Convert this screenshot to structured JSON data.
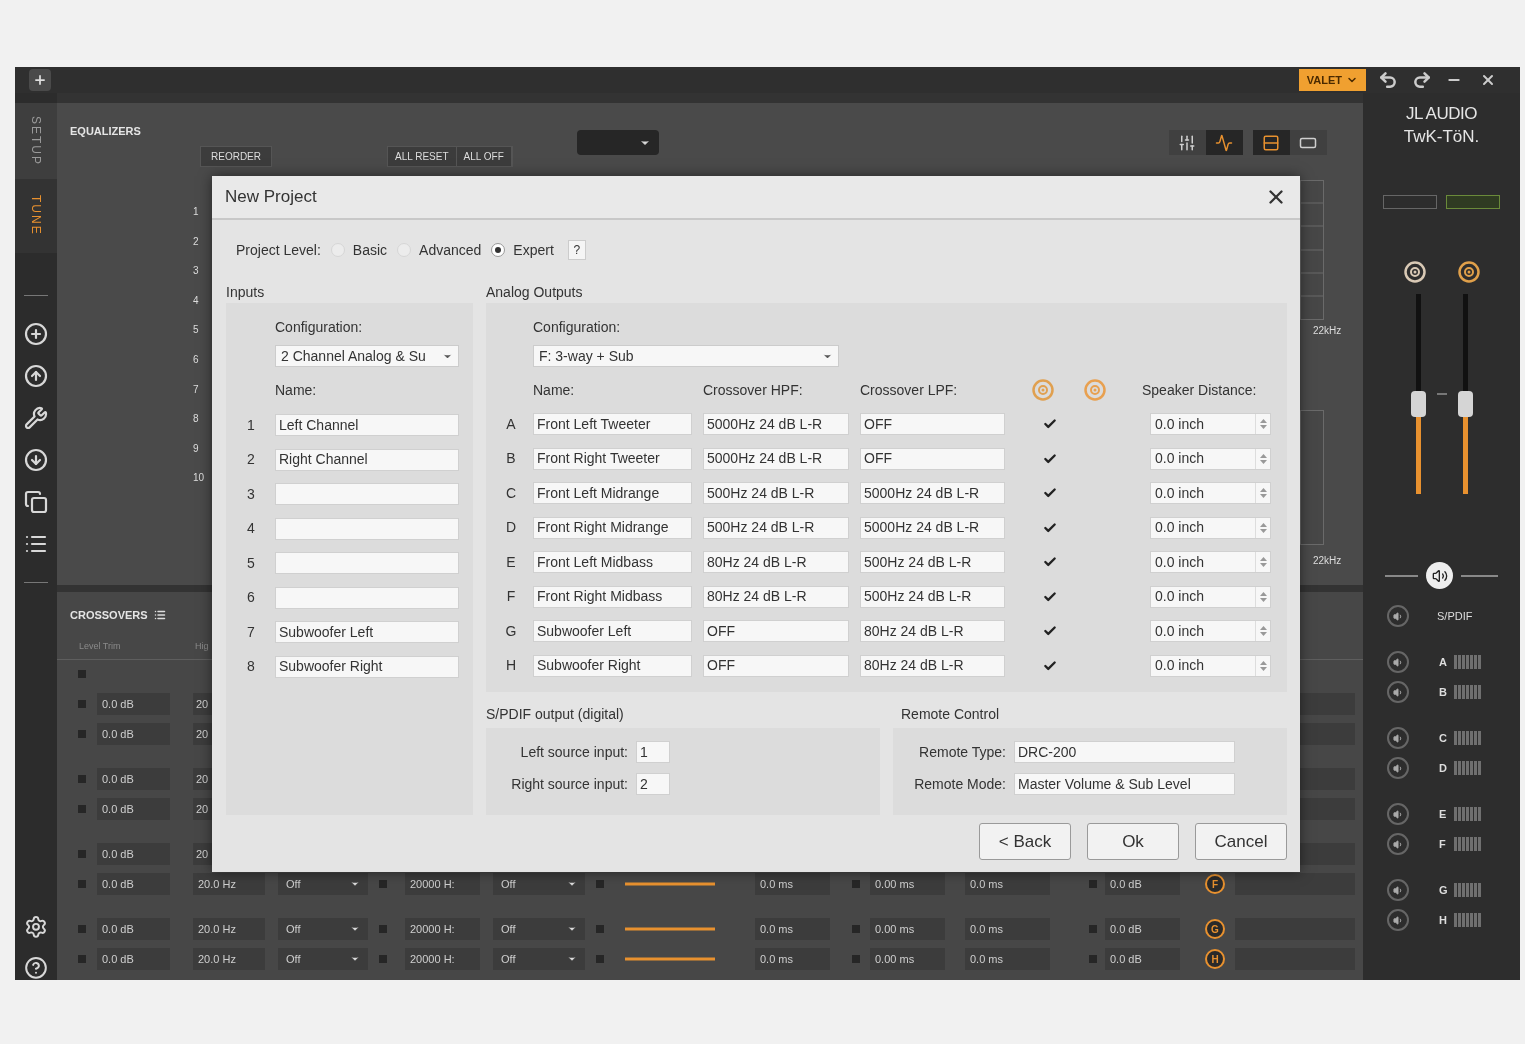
{
  "top_bar": {
    "valet": "VALET"
  },
  "side_tabs": [
    {
      "label": "SETUP",
      "selected": false
    },
    {
      "label": "TUNE",
      "selected": true
    }
  ],
  "equalizers": {
    "title": "EQUALIZERS",
    "reorder": "REORDER",
    "buttons": [
      "ALL RESET",
      "ALL OFF"
    ],
    "view_buttons": [
      {
        "selected": false
      },
      {
        "selected": true
      },
      {
        "selected": true
      },
      {
        "selected": false
      }
    ],
    "band_numbers": [
      "1",
      "2",
      "3",
      "4",
      "5",
      "6",
      "7",
      "8",
      "9",
      "10"
    ],
    "freq_labels": [
      "22kHz",
      "22kHz"
    ]
  },
  "crossovers": {
    "title": "CROSSOVERS",
    "columns": [
      "Level Trim",
      "Hig"
    ],
    "groups": [
      [
        {
          "kind": "blank"
        },
        {
          "kind": "partial",
          "level": "0.0 dB",
          "hz": "20"
        },
        {
          "kind": "partial",
          "level": "0.0 dB",
          "hz": "20"
        }
      ],
      [
        {
          "kind": "partial",
          "level": "0.0 dB",
          "hz": "20"
        },
        {
          "kind": "partial",
          "level": "0.0 dB",
          "hz": "20"
        }
      ],
      [
        {
          "kind": "partial",
          "level": "0.0 dB",
          "hz": "20"
        },
        {
          "kind": "full",
          "level": "0.0 dB",
          "hpf_freq": "20.0 Hz",
          "hpf_slope": "Off",
          "lpf_freq": "20000 H:",
          "lpf_slope": "Off",
          "delay": "0.0 ms",
          "delay_fine": "0.00 ms",
          "delay_total": "0.0 ms",
          "gain": "0.0 dB",
          "letter": "F"
        }
      ],
      [
        {
          "kind": "full",
          "level": "0.0 dB",
          "hpf_freq": "20.0 Hz",
          "hpf_slope": "Off",
          "lpf_freq": "20000 H:",
          "lpf_slope": "Off",
          "delay": "0.0 ms",
          "delay_fine": "0.00 ms",
          "delay_total": "0.0 ms",
          "gain": "0.0 dB",
          "letter": "G"
        },
        {
          "kind": "full",
          "level": "0.0 dB",
          "hpf_freq": "20.0 Hz",
          "hpf_slope": "Off",
          "lpf_freq": "20000 H:",
          "lpf_slope": "Off",
          "delay": "0.0 ms",
          "delay_fine": "0.00 ms",
          "delay_total": "0.0 ms",
          "gain": "0.0 dB",
          "letter": "H"
        }
      ]
    ]
  },
  "brand": {
    "line1": "JL AUDIO",
    "line2": "TwK-TöN."
  },
  "faders": [
    {
      "level": 0.45
    },
    {
      "level": 0.45
    }
  ],
  "mute_groups": [
    [
      {
        "kind": "plain",
        "label": "S/PDIF"
      }
    ],
    [
      {
        "kind": "meter",
        "label": "A"
      },
      {
        "kind": "meter",
        "label": "B"
      }
    ],
    [
      {
        "kind": "meter",
        "label": "C"
      },
      {
        "kind": "meter",
        "label": "D"
      }
    ],
    [
      {
        "kind": "meter",
        "label": "E"
      },
      {
        "kind": "meter",
        "label": "F"
      }
    ],
    [
      {
        "kind": "meter",
        "label": "G"
      },
      {
        "kind": "meter",
        "label": "H"
      }
    ]
  ],
  "dialog": {
    "title": "New Project",
    "level_label": "Project Level:",
    "levels": [
      {
        "label": "Basic",
        "selected": false
      },
      {
        "label": "Advanced",
        "selected": false
      },
      {
        "label": "Expert",
        "selected": true
      }
    ],
    "help": "?",
    "inputs": {
      "title": "Inputs",
      "config_label": "Configuration:",
      "config_value": "2 Channel Analog & Su",
      "name_label": "Name:",
      "rows": [
        {
          "number": "1",
          "name": "Left Channel"
        },
        {
          "number": "2",
          "name": "Right Channel"
        },
        {
          "number": "3"
        },
        {
          "number": "4"
        },
        {
          "number": "5"
        },
        {
          "number": "6"
        },
        {
          "number": "7",
          "name": "Subwoofer Left"
        },
        {
          "number": "8",
          "name": "Subwoofer Right"
        }
      ]
    },
    "outputs": {
      "title": "Analog Outputs",
      "config_label": "Configuration:",
      "config_value": "F: 3-way + Sub",
      "columns": [
        "Name:",
        "Crossover HPF:",
        "Crossover LPF:",
        "Speaker Distance:"
      ],
      "rows": [
        {
          "letter": "A",
          "name": "Front Left Tweeter",
          "hpf": "5000Hz 24 dB L-R",
          "lpf": "OFF",
          "left_on": true,
          "distance": "0.0 inch"
        },
        {
          "letter": "B",
          "name": "Front Right Tweeter",
          "hpf": "5000Hz 24 dB L-R",
          "lpf": "OFF",
          "left_on": true,
          "distance": "0.0 inch"
        },
        {
          "letter": "C",
          "name": "Front Left Midrange",
          "hpf": "500Hz 24 dB L-R",
          "lpf": "5000Hz 24 dB L-R",
          "left_on": true,
          "distance": "0.0 inch"
        },
        {
          "letter": "D",
          "name": "Front Right Midrange",
          "hpf": "500Hz 24 dB L-R",
          "lpf": "5000Hz 24 dB L-R",
          "left_on": true,
          "distance": "0.0 inch"
        },
        {
          "letter": "E",
          "name": "Front Left Midbass",
          "hpf": "80Hz 24 dB L-R",
          "lpf": "500Hz 24 dB L-R",
          "left_on": true,
          "distance": "0.0 inch"
        },
        {
          "letter": "F",
          "name": "Front Right Midbass",
          "hpf": "80Hz 24 dB L-R",
          "lpf": "500Hz 24 dB L-R",
          "left_on": true,
          "distance": "0.0 inch"
        },
        {
          "letter": "G",
          "name": "Subwoofer Left",
          "hpf": "OFF",
          "lpf": "80Hz 24 dB L-R",
          "left_on": true,
          "distance": "0.0 inch"
        },
        {
          "letter": "H",
          "name": "Subwoofer Right",
          "hpf": "OFF",
          "lpf": "80Hz 24 dB L-R",
          "left_on": true,
          "distance": "0.0 inch"
        }
      ]
    },
    "spdif": {
      "title": "S/PDIF output (digital)",
      "fields": [
        {
          "label": "Left source input:",
          "value": "1"
        },
        {
          "label": "Right source input:",
          "value": "2"
        }
      ]
    },
    "remote": {
      "title": "Remote Control",
      "fields": [
        {
          "label": "Remote Type:",
          "value": "DRC-200"
        },
        {
          "label": "Remote Mode:",
          "value": "Master Volume & Sub Level"
        }
      ]
    },
    "buttons": [
      "< Back",
      "Ok",
      "Cancel"
    ]
  }
}
